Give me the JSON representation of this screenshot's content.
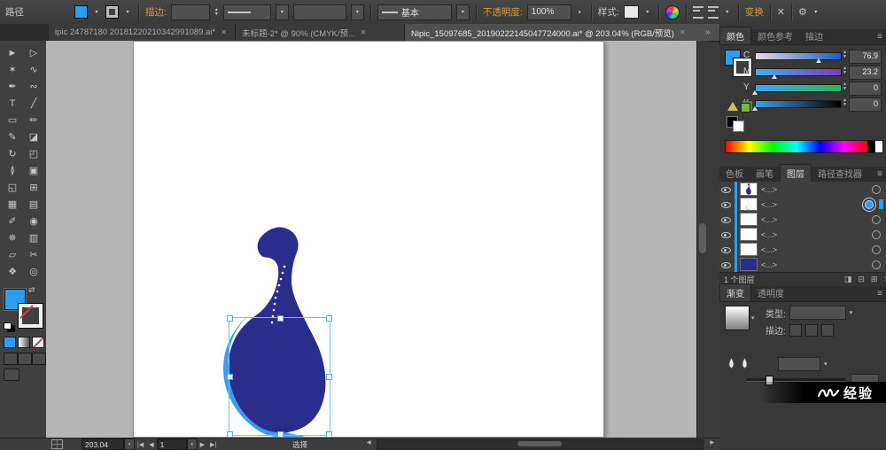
{
  "colors": {
    "accent_blue": "#2e9df7",
    "swan_dark": "#2b2d8c",
    "swan_light": "#3a9df2",
    "selection_stroke": "#6fc3ec",
    "link_orange": "#d79a3e"
  },
  "icons": {
    "caret_down": "▾",
    "caret_right": "▸",
    "close": "✕",
    "menu": "≡",
    "chevrons_left": "«",
    "chevrons_right": "»",
    "gear": "⚙",
    "swap": "⇄",
    "isolate": "✕",
    "nav_first": "|◀",
    "nav_prev": "◀",
    "nav_next": "▶",
    "nav_last": "▶|",
    "scroll_left": "◀",
    "scroll_right": "▶",
    "spin_up": "▲",
    "spin_down": "▼",
    "new_sublayer": "⊟",
    "new_layer": "⊞",
    "make_mask": "◨",
    "delete_layer": "✕"
  },
  "control_bar": {
    "object_label": "路径",
    "stroke_label": "描边:",
    "profile_value": "基本",
    "opacity_label": "不透明度:",
    "opacity_value": "100%",
    "style_label": "样式:",
    "transform_label": "变换"
  },
  "document_tabs": [
    {
      "title": "ipic 24787180 20181220210342991089.ai*",
      "active": false
    },
    {
      "title": "未标题-2* @ 90% (CMYK/预...",
      "active": false
    },
    {
      "title": "Nipic_15097685_20190222145047724000.ai* @ 203.04% (RGB/预览)",
      "active": true
    }
  ],
  "toolbar": {
    "tools": [
      {
        "name": "selection-tool",
        "glyph": "►"
      },
      {
        "name": "direct-selection-tool",
        "glyph": "▷"
      },
      {
        "name": "magic-wand-tool",
        "glyph": "✶"
      },
      {
        "name": "lasso-tool",
        "glyph": "∿"
      },
      {
        "name": "pen-tool",
        "glyph": "✒"
      },
      {
        "name": "curvature-tool",
        "glyph": "∾"
      },
      {
        "name": "type-tool",
        "glyph": "T"
      },
      {
        "name": "line-segment-tool",
        "glyph": "╱"
      },
      {
        "name": "rectangle-tool",
        "glyph": "▭"
      },
      {
        "name": "paintbrush-tool",
        "glyph": "✏"
      },
      {
        "name": "pencil-tool",
        "glyph": "✎"
      },
      {
        "name": "eraser-tool",
        "glyph": "◪"
      },
      {
        "name": "rotate-tool",
        "glyph": "↻"
      },
      {
        "name": "scale-tool",
        "glyph": "◰"
      },
      {
        "name": "width-tool",
        "glyph": "≬"
      },
      {
        "name": "free-transform-tool",
        "glyph": "▣"
      },
      {
        "name": "shape-builder-tool",
        "glyph": "◱"
      },
      {
        "name": "perspective-grid-tool",
        "glyph": "⊞"
      },
      {
        "name": "mesh-tool",
        "glyph": "▦"
      },
      {
        "name": "gradient-tool",
        "glyph": "▤"
      },
      {
        "name": "eyedropper-tool",
        "glyph": "✐"
      },
      {
        "name": "blend-tool",
        "glyph": "◉"
      },
      {
        "name": "symbol-sprayer-tool",
        "glyph": "✵"
      },
      {
        "name": "column-graph-tool",
        "glyph": "▥"
      },
      {
        "name": "artboard-tool",
        "glyph": "▱"
      },
      {
        "name": "slice-tool",
        "glyph": "✂"
      },
      {
        "name": "hand-tool",
        "glyph": "❖"
      },
      {
        "name": "zoom-tool",
        "glyph": "◎"
      }
    ]
  },
  "color_panel": {
    "tabs": [
      "颜色",
      "颜色参考",
      "描边"
    ],
    "channels": [
      {
        "label": "C",
        "value": "76.9",
        "pct": 76.9
      },
      {
        "label": "M",
        "value": "23.2",
        "pct": 23.2
      },
      {
        "label": "Y",
        "value": "0",
        "pct": 0
      },
      {
        "label": "K",
        "value": "0",
        "pct": 0
      }
    ]
  },
  "dock_tabs": [
    "色板",
    "画笔",
    "图层",
    "路径查找器"
  ],
  "layers_panel": {
    "rows": [
      {
        "label": "<...>"
      },
      {
        "label": "<...>"
      },
      {
        "label": "<...>"
      },
      {
        "label": "<...>"
      },
      {
        "label": "<...>"
      },
      {
        "label": "<...>"
      }
    ],
    "footer": "1 个图层"
  },
  "gradient_panel": {
    "tabs": [
      "渐变",
      "透明度"
    ],
    "type_label": "类型:",
    "stroke_label": "描边:"
  },
  "status_bar": {
    "zoom": "203.04",
    "artboard": "1",
    "hint": "选择"
  },
  "watermark": {
    "text": "经验"
  }
}
